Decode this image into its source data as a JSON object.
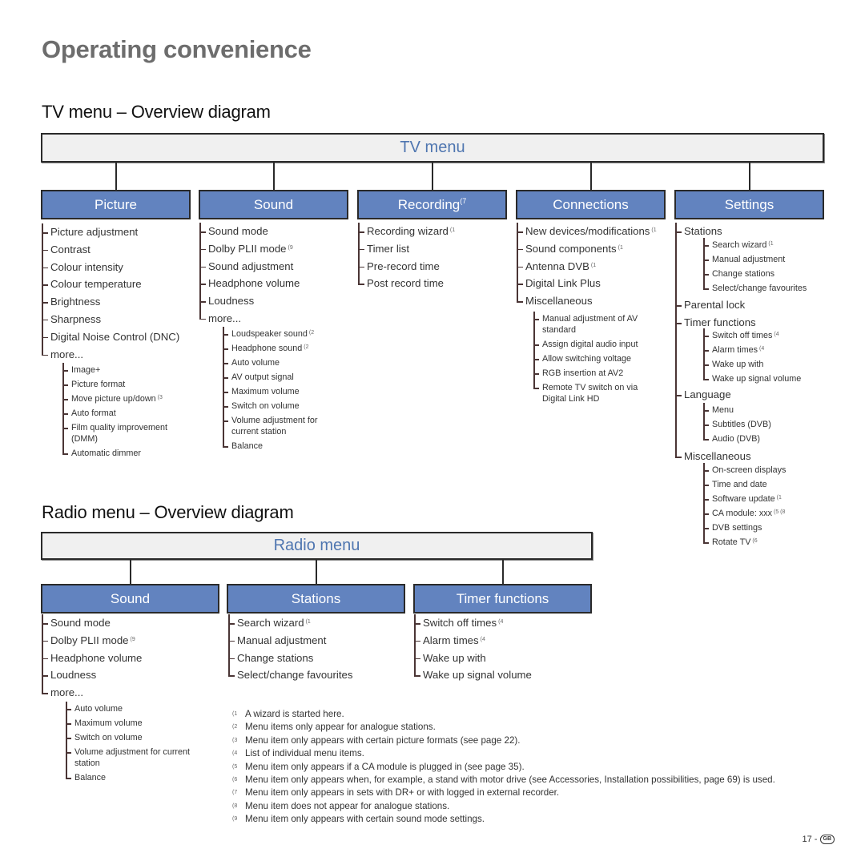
{
  "page_title": "Operating convenience",
  "tv_section": {
    "title": "TV menu – Overview diagram",
    "menu_label": "TV menu",
    "categories": [
      {
        "label": "Picture",
        "fn": "",
        "items": [
          "Picture adjustment",
          "Contrast",
          "Colour intensity",
          "Colour temperature",
          "Brightness",
          "Sharpness",
          "Digital Noise Control (DNC)",
          "more..."
        ],
        "sub": [
          {
            "text": "Image+",
            "fn": ""
          },
          {
            "text": "Picture format",
            "fn": ""
          },
          {
            "text": "Move picture up/down",
            "fn": "(3"
          },
          {
            "text": "Auto format",
            "fn": ""
          },
          {
            "text": "Film quality improvement (DMM)",
            "fn": ""
          },
          {
            "text": "Automatic dimmer",
            "fn": ""
          }
        ]
      },
      {
        "label": "Sound",
        "fn": "",
        "items": [
          {
            "text": "Sound mode",
            "fn": ""
          },
          {
            "text": "Dolby PLII mode",
            "fn": "(9"
          },
          {
            "text": "Sound adjustment",
            "fn": ""
          },
          {
            "text": "Headphone volume",
            "fn": ""
          },
          {
            "text": "Loudness",
            "fn": ""
          },
          {
            "text": "more...",
            "fn": ""
          }
        ],
        "sub": [
          {
            "text": "Loudspeaker sound",
            "fn": "(2"
          },
          {
            "text": "Headphone sound",
            "fn": "(2"
          },
          {
            "text": "Auto volume",
            "fn": ""
          },
          {
            "text": "AV output signal",
            "fn": ""
          },
          {
            "text": "Maximum volume",
            "fn": ""
          },
          {
            "text": "Switch on volume",
            "fn": ""
          },
          {
            "text": "Volume adjustment for current station",
            "fn": ""
          },
          {
            "text": "Balance",
            "fn": ""
          }
        ]
      },
      {
        "label": "Recording",
        "fn": "(7",
        "items": [
          {
            "text": "Recording wizard",
            "fn": "(1"
          },
          {
            "text": "Timer list",
            "fn": ""
          },
          {
            "text": "Pre-record time",
            "fn": ""
          },
          {
            "text": "Post record time",
            "fn": ""
          }
        ]
      },
      {
        "label": "Connections",
        "fn": "",
        "items": [
          {
            "text": "New devices/modifications",
            "fn": "(1"
          },
          {
            "text": "Sound components",
            "fn": "(1"
          },
          {
            "text": "Antenna DVB",
            "fn": "(1"
          },
          {
            "text": "Digital Link Plus",
            "fn": ""
          },
          {
            "text": "Miscellaneous",
            "fn": ""
          }
        ],
        "sub": [
          {
            "text": "Manual adjustment of AV standard",
            "fn": ""
          },
          {
            "text": "Assign digital audio input",
            "fn": ""
          },
          {
            "text": "Allow switching voltage",
            "fn": ""
          },
          {
            "text": "RGB insertion at AV2",
            "fn": ""
          },
          {
            "text": "Remote TV switch on via Digital Link HD",
            "fn": ""
          }
        ]
      },
      {
        "label": "Settings",
        "fn": "",
        "groups": [
          {
            "text": "Stations",
            "sub": [
              {
                "text": "Search wizard",
                "fn": "(1"
              },
              {
                "text": "Manual adjustment",
                "fn": ""
              },
              {
                "text": "Change stations",
                "fn": ""
              },
              {
                "text": "Select/change favourites",
                "fn": ""
              }
            ]
          },
          {
            "text": "Parental lock",
            "sub": []
          },
          {
            "text": "Timer functions",
            "sub": [
              {
                "text": "Switch off times",
                "fn": "(4"
              },
              {
                "text": "Alarm times",
                "fn": "(4"
              },
              {
                "text": "Wake up with",
                "fn": ""
              },
              {
                "text": "Wake up signal volume",
                "fn": ""
              }
            ]
          },
          {
            "text": "Language",
            "sub": [
              {
                "text": "Menu",
                "fn": ""
              },
              {
                "text": "Subtitles (DVB)",
                "fn": ""
              },
              {
                "text": "Audio (DVB)",
                "fn": ""
              }
            ]
          },
          {
            "text": "Miscellaneous",
            "sub": [
              {
                "text": "On-screen displays",
                "fn": ""
              },
              {
                "text": "Time and date",
                "fn": ""
              },
              {
                "text": "Software update",
                "fn": "(1"
              },
              {
                "text": "CA module: xxx",
                "fn": "(5 (8"
              },
              {
                "text": "DVB settings",
                "fn": ""
              },
              {
                "text": "Rotate TV",
                "fn": "(6"
              }
            ]
          }
        ]
      }
    ]
  },
  "radio_section": {
    "title": "Radio menu – Overview diagram",
    "menu_label": "Radio menu",
    "categories": [
      {
        "label": "Sound",
        "items": [
          {
            "text": "Sound mode",
            "fn": ""
          },
          {
            "text": "Dolby PLII mode",
            "fn": "(9"
          },
          {
            "text": "Headphone volume",
            "fn": ""
          },
          {
            "text": "Loudness",
            "fn": ""
          },
          {
            "text": "more...",
            "fn": ""
          }
        ],
        "sub": [
          {
            "text": "Auto volume",
            "fn": ""
          },
          {
            "text": "Maximum volume",
            "fn": ""
          },
          {
            "text": "Switch on volume",
            "fn": ""
          },
          {
            "text": "Volume adjustment for current station",
            "fn": ""
          },
          {
            "text": "Balance",
            "fn": ""
          }
        ]
      },
      {
        "label": "Stations",
        "items": [
          {
            "text": "Search wizard",
            "fn": "(1"
          },
          {
            "text": "Manual adjustment",
            "fn": ""
          },
          {
            "text": "Change stations",
            "fn": ""
          },
          {
            "text": "Select/change favourites",
            "fn": ""
          }
        ]
      },
      {
        "label": "Timer functions",
        "items": [
          {
            "text": "Switch off times",
            "fn": "(4"
          },
          {
            "text": "Alarm times",
            "fn": "(4"
          },
          {
            "text": "Wake up with",
            "fn": ""
          },
          {
            "text": "Wake up signal volume",
            "fn": ""
          }
        ]
      }
    ]
  },
  "footnotes": [
    {
      "mark": "(1",
      "text": "A wizard is started here."
    },
    {
      "mark": "(2",
      "text": "Menu items only appear for analogue stations."
    },
    {
      "mark": "(3",
      "text": "Menu item only appears with certain picture formats (see page 22)."
    },
    {
      "mark": "(4",
      "text": "List of individual menu items."
    },
    {
      "mark": "(5",
      "text": "Menu item only appears if a CA module is plugged in (see page 35)."
    },
    {
      "mark": "(6",
      "text": "Menu item only appears when, for example, a stand with motor drive (see Accessories, Installation possibilities, page 69) is used."
    },
    {
      "mark": "(7",
      "text": "Menu item only appears in sets with DR+ or with logged in external recorder."
    },
    {
      "mark": "(8",
      "text": "Menu item does not appear for analogue stations."
    },
    {
      "mark": "(9",
      "text": "Menu item only appears with certain sound mode settings."
    }
  ],
  "page_number": "17 -",
  "country_badge": "GB"
}
